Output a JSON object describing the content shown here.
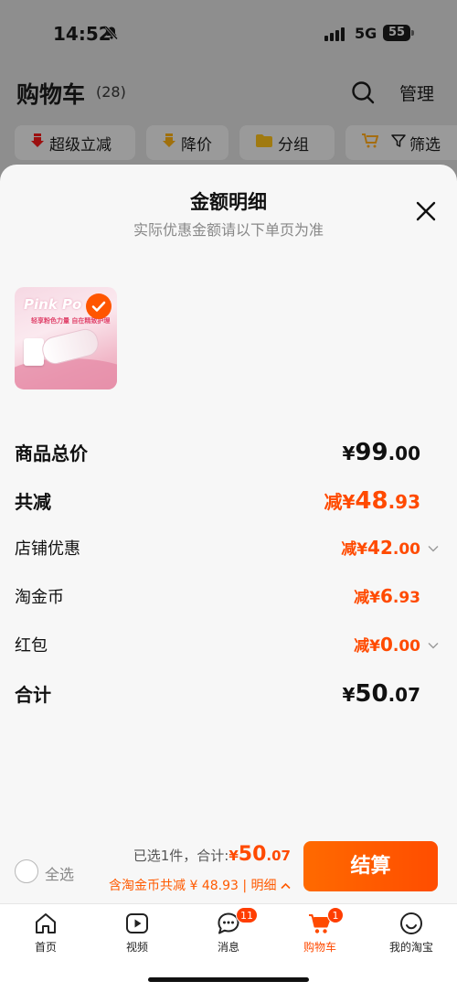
{
  "status_bar": {
    "time": "14:52",
    "network": "5G",
    "battery": "55"
  },
  "background": {
    "title": "购物车",
    "count": "(28)",
    "manage": "管理",
    "chips": [
      "超级立减",
      "降价",
      "分组",
      "筛选"
    ]
  },
  "sheet": {
    "title": "金额明细",
    "subtitle": "实际优惠金额请以下单页为准",
    "product": {
      "brand_text": "Pink Po",
      "slogan": "轻享粉色力量 自在精致护理"
    },
    "rows": [
      {
        "label": "商品总价",
        "prefix": "",
        "currency": "¥",
        "int": "99",
        "dec": ".00",
        "has_arrow": false
      },
      {
        "label": "共减",
        "prefix": "减",
        "currency": "¥",
        "int": "48",
        "dec": ".93",
        "has_arrow": false
      },
      {
        "label": "店铺优惠",
        "prefix": "减",
        "currency": "¥",
        "int": "42",
        "dec": ".00",
        "has_arrow": true
      },
      {
        "label": "淘金币",
        "prefix": "减",
        "currency": "¥",
        "int": "6",
        "dec": ".93",
        "has_arrow": false
      },
      {
        "label": "红包",
        "prefix": "减",
        "currency": "¥",
        "int": "0",
        "dec": ".00",
        "has_arrow": true
      },
      {
        "label": "合计",
        "prefix": "",
        "currency": "¥",
        "int": "50",
        "dec": ".07",
        "has_arrow": false
      }
    ]
  },
  "checkout_bar": {
    "select_all": "全选",
    "selected_text": "已选1件，合计:",
    "total_currency": "¥",
    "total_int": "50",
    "total_dec": ".07",
    "discount_text": "含淘金币共减 ¥ 48.93 | 明细",
    "checkout_label": "结算"
  },
  "tabbar": {
    "items": [
      {
        "label": "首页",
        "icon": "home-icon"
      },
      {
        "label": "视频",
        "icon": "video-icon"
      },
      {
        "label": "消息",
        "icon": "message-icon",
        "badge": "11"
      },
      {
        "label": "购物车",
        "icon": "cart-icon",
        "badge": "1",
        "active": true
      },
      {
        "label": "我的淘宝",
        "icon": "profile-icon"
      }
    ]
  },
  "colors": {
    "accent": "#ff4a00",
    "sheet_bg": "#f7f7f7",
    "overlay": "#8e8e8e"
  }
}
